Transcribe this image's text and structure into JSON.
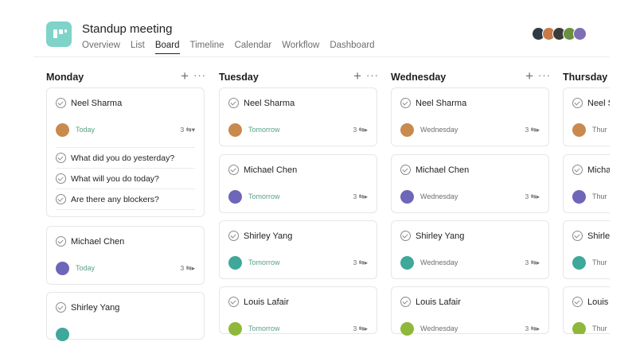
{
  "header": {
    "title": "Standup meeting",
    "tabs": [
      "Overview",
      "List",
      "Board",
      "Timeline",
      "Calendar",
      "Workflow",
      "Dashboard"
    ],
    "active_tab": "Board",
    "member_avatar_colors": [
      "#2f3a45",
      "#c77a4a",
      "#3b3b3b",
      "#6a8f3d",
      "#7e6fb3"
    ]
  },
  "columns": [
    {
      "title": "Monday",
      "add": "+",
      "more": "···",
      "cards": [
        {
          "name": "Neel Sharma",
          "date": "Today",
          "subtasks_count": "3 ⇆▾",
          "avatar_color": "#c98a4e",
          "expanded": true,
          "subtasks": [
            "What did you do yesterday?",
            "What will you do today?",
            "Are there any blockers?"
          ]
        },
        {
          "name": "Michael Chen",
          "date": "Today",
          "subtasks_count": "3 ⇆▸",
          "avatar_color": "#6e66b8"
        },
        {
          "name": "Shirley Yang",
          "date": "",
          "subtasks_count": "",
          "avatar_color": "#3ea89a"
        }
      ]
    },
    {
      "title": "Tuesday",
      "add": "+",
      "more": "···",
      "cards": [
        {
          "name": "Neel Sharma",
          "date": "Tomorrow",
          "subtasks_count": "3 ⇆▸",
          "avatar_color": "#c98a4e"
        },
        {
          "name": "Michael Chen",
          "date": "Tomorrow",
          "subtasks_count": "3 ⇆▸",
          "avatar_color": "#6e66b8"
        },
        {
          "name": "Shirley Yang",
          "date": "Tomorrow",
          "subtasks_count": "3 ⇆▸",
          "avatar_color": "#3ea89a"
        },
        {
          "name": "Louis Lafair",
          "date": "Tomorrow",
          "subtasks_count": "3 ⇆▸",
          "avatar_color": "#8fb83a"
        }
      ]
    },
    {
      "title": "Wednesday",
      "add": "+",
      "more": "···",
      "cards": [
        {
          "name": "Neel Sharma",
          "date": "Wednesday",
          "subtasks_count": "3 ⇆▸",
          "avatar_color": "#c98a4e"
        },
        {
          "name": "Michael Chen",
          "date": "Wednesday",
          "subtasks_count": "3 ⇆▸",
          "avatar_color": "#6e66b8"
        },
        {
          "name": "Shirley Yang",
          "date": "Wednesday",
          "subtasks_count": "3 ⇆▸",
          "avatar_color": "#3ea89a"
        },
        {
          "name": "Louis Lafair",
          "date": "Wednesday",
          "subtasks_count": "3 ⇆▸",
          "avatar_color": "#8fb83a"
        }
      ]
    },
    {
      "title": "Thursday",
      "cards": [
        {
          "name": "Neel S",
          "date": "Thur",
          "avatar_color": "#c98a4e"
        },
        {
          "name": "Micha",
          "date": "Thur",
          "avatar_color": "#6e66b8"
        },
        {
          "name": "Shirle",
          "date": "Thur",
          "avatar_color": "#3ea89a"
        },
        {
          "name": "Louis",
          "date": "Thur",
          "avatar_color": "#8fb83a"
        }
      ]
    }
  ]
}
